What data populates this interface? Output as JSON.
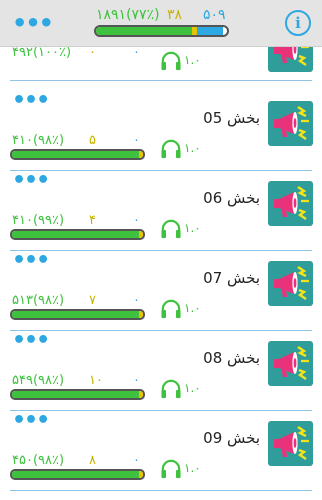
{
  "header": {
    "menu_icon": "more-dots-icon",
    "info_icon": "info-icon",
    "info_label": "i",
    "stat_correct": "۱۸۹۱(۷۷٪)",
    "stat_wrong": "۳۸",
    "stat_total": "۵۰۹",
    "progress": {
      "green": 0.73,
      "yellow": 0.04,
      "blue": 0.2
    }
  },
  "colors": {
    "green": "#3ec23e",
    "yellow": "#e3c400",
    "blue": "#2ea8e3",
    "teal": "#2f9e9a",
    "pink": "#e8337a"
  },
  "rows": [
    {
      "title": "",
      "correct": "۴۹۲(۱۰۰٪)",
      "wrong": "۰",
      "remaining": "۰",
      "speed": "۱.۰",
      "progress": {
        "green": 1.0,
        "yellow": 0.0,
        "blue": 0.0
      }
    },
    {
      "title": "بخش 05",
      "correct": "۴۱۰(۹۸٪)",
      "wrong": "۵",
      "remaining": "۰",
      "speed": "۱.۰",
      "progress": {
        "green": 0.97,
        "yellow": 0.03,
        "blue": 0.0
      }
    },
    {
      "title": "بخش 06",
      "correct": "۴۱۰(۹۹٪)",
      "wrong": "۴",
      "remaining": "۰",
      "speed": "۱.۰",
      "progress": {
        "green": 0.97,
        "yellow": 0.03,
        "blue": 0.0
      }
    },
    {
      "title": "بخش 07",
      "correct": "۵۱۳(۹۸٪)",
      "wrong": "۷",
      "remaining": "۰",
      "speed": "۱.۰",
      "progress": {
        "green": 0.97,
        "yellow": 0.03,
        "blue": 0.0
      }
    },
    {
      "title": "بخش 08",
      "correct": "۵۴۹(۹۸٪)",
      "wrong": "۱۰",
      "remaining": "۰",
      "speed": "۱.۰",
      "progress": {
        "green": 0.97,
        "yellow": 0.03,
        "blue": 0.0
      }
    },
    {
      "title": "بخش 09",
      "correct": "۴۵۰(۹۸٪)",
      "wrong": "۸",
      "remaining": "۰",
      "speed": "۱.۰",
      "progress": {
        "green": 0.97,
        "yellow": 0.03,
        "blue": 0.0
      }
    }
  ]
}
